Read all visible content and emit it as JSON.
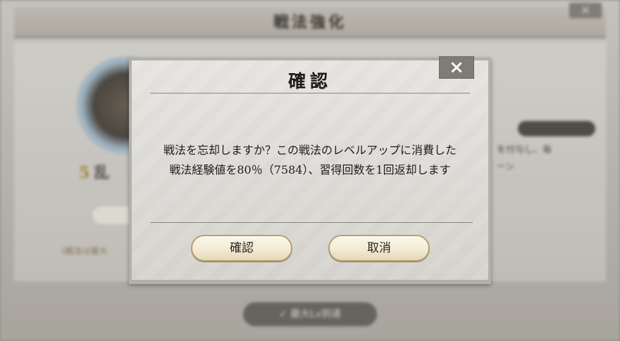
{
  "background": {
    "title": "戦法強化",
    "close_label": "×",
    "top_text": "",
    "skill_grade": "5",
    "skill_name": "乱",
    "sub_label": "",
    "left_pill_label": "",
    "note": "(戦法は最大",
    "tag_label": "",
    "right_line1": "を付与し、毎",
    "right_line2": "ーン",
    "bottom_button": "最大Lv到達"
  },
  "dialog": {
    "title": "確認",
    "close_label": "×",
    "message_line1": "戦法を忘却しますか？この戦法のレベルアップに消費した",
    "message_line2": "戦法経験値を80％（7584）、習得回数を1回返却します",
    "confirm_label": "確認",
    "cancel_label": "取消"
  },
  "colors": {
    "accent_gold": "#b08a3a",
    "button_border": "#b79f73",
    "close_bg": "#7f7b75"
  }
}
